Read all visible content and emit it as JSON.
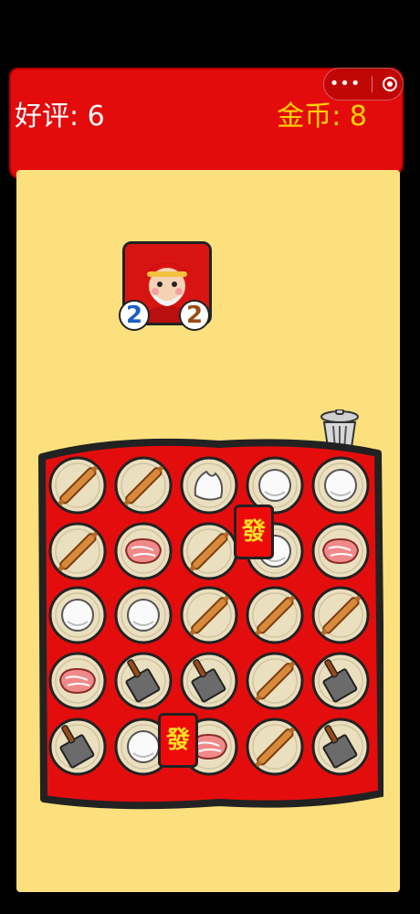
{
  "header": {
    "praise_label": "好评: 6",
    "coins_label": "金币: 8",
    "menu_icon": "more-dots-icon",
    "close_icon": "target-close-icon",
    "color_bg": "#e30b0b",
    "color_coins": "#ffd400"
  },
  "customer": {
    "portrait": "grandpa-icon",
    "order_count_blue": "2",
    "order_count_brown": "2"
  },
  "trash_icon": "trash-can-icon",
  "board": {
    "rows": [
      [
        "rolling-pin",
        "rolling-pin",
        "dough",
        "bun",
        "bun"
      ],
      [
        "rolling-pin",
        "meat",
        "rolling-pin",
        "bun",
        "meat"
      ],
      [
        "bun",
        "bun",
        "rolling-pin",
        "rolling-pin",
        "rolling-pin"
      ],
      [
        "meat",
        "cleaver",
        "cleaver",
        "rolling-pin",
        "cleaver"
      ],
      [
        "cleaver",
        "bun",
        "meat",
        "rolling-pin",
        "cleaver"
      ]
    ],
    "tokens": [
      {
        "label": "發",
        "name": "fa-token-1"
      },
      {
        "label": "發",
        "name": "fa-token-2"
      }
    ]
  }
}
